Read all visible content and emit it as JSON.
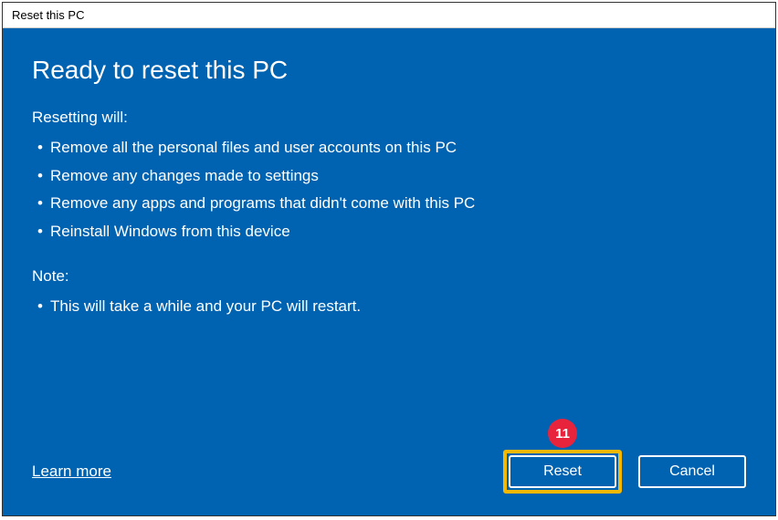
{
  "window": {
    "title": "Reset this PC"
  },
  "heading": "Ready to reset this PC",
  "section1": {
    "label": "Resetting will:",
    "items": [
      "Remove all the personal files and user accounts on this PC",
      "Remove any changes made to settings",
      "Remove any apps and programs that didn't come with this PC",
      "Reinstall Windows from this device"
    ]
  },
  "section2": {
    "label": "Note:",
    "items": [
      "This will take a while and your PC will restart."
    ]
  },
  "footer": {
    "learn_more": "Learn more",
    "reset": "Reset",
    "cancel": "Cancel"
  },
  "annotation": {
    "step_number": "11"
  }
}
